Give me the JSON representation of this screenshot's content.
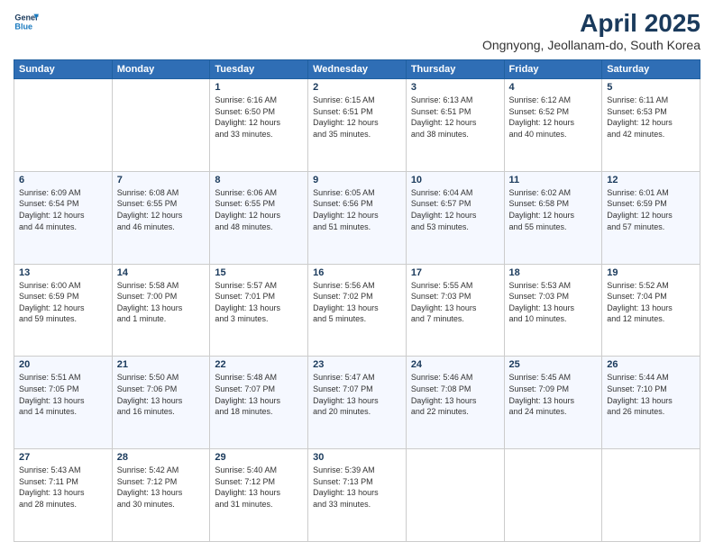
{
  "logo": {
    "line1": "General",
    "line2": "Blue"
  },
  "title": "April 2025",
  "subtitle": "Ongnyong, Jeollanam-do, South Korea",
  "days_header": [
    "Sunday",
    "Monday",
    "Tuesday",
    "Wednesday",
    "Thursday",
    "Friday",
    "Saturday"
  ],
  "weeks": [
    [
      {
        "day": "",
        "info": ""
      },
      {
        "day": "",
        "info": ""
      },
      {
        "day": "1",
        "info": "Sunrise: 6:16 AM\nSunset: 6:50 PM\nDaylight: 12 hours\nand 33 minutes."
      },
      {
        "day": "2",
        "info": "Sunrise: 6:15 AM\nSunset: 6:51 PM\nDaylight: 12 hours\nand 35 minutes."
      },
      {
        "day": "3",
        "info": "Sunrise: 6:13 AM\nSunset: 6:51 PM\nDaylight: 12 hours\nand 38 minutes."
      },
      {
        "day": "4",
        "info": "Sunrise: 6:12 AM\nSunset: 6:52 PM\nDaylight: 12 hours\nand 40 minutes."
      },
      {
        "day": "5",
        "info": "Sunrise: 6:11 AM\nSunset: 6:53 PM\nDaylight: 12 hours\nand 42 minutes."
      }
    ],
    [
      {
        "day": "6",
        "info": "Sunrise: 6:09 AM\nSunset: 6:54 PM\nDaylight: 12 hours\nand 44 minutes."
      },
      {
        "day": "7",
        "info": "Sunrise: 6:08 AM\nSunset: 6:55 PM\nDaylight: 12 hours\nand 46 minutes."
      },
      {
        "day": "8",
        "info": "Sunrise: 6:06 AM\nSunset: 6:55 PM\nDaylight: 12 hours\nand 48 minutes."
      },
      {
        "day": "9",
        "info": "Sunrise: 6:05 AM\nSunset: 6:56 PM\nDaylight: 12 hours\nand 51 minutes."
      },
      {
        "day": "10",
        "info": "Sunrise: 6:04 AM\nSunset: 6:57 PM\nDaylight: 12 hours\nand 53 minutes."
      },
      {
        "day": "11",
        "info": "Sunrise: 6:02 AM\nSunset: 6:58 PM\nDaylight: 12 hours\nand 55 minutes."
      },
      {
        "day": "12",
        "info": "Sunrise: 6:01 AM\nSunset: 6:59 PM\nDaylight: 12 hours\nand 57 minutes."
      }
    ],
    [
      {
        "day": "13",
        "info": "Sunrise: 6:00 AM\nSunset: 6:59 PM\nDaylight: 12 hours\nand 59 minutes."
      },
      {
        "day": "14",
        "info": "Sunrise: 5:58 AM\nSunset: 7:00 PM\nDaylight: 13 hours\nand 1 minute."
      },
      {
        "day": "15",
        "info": "Sunrise: 5:57 AM\nSunset: 7:01 PM\nDaylight: 13 hours\nand 3 minutes."
      },
      {
        "day": "16",
        "info": "Sunrise: 5:56 AM\nSunset: 7:02 PM\nDaylight: 13 hours\nand 5 minutes."
      },
      {
        "day": "17",
        "info": "Sunrise: 5:55 AM\nSunset: 7:03 PM\nDaylight: 13 hours\nand 7 minutes."
      },
      {
        "day": "18",
        "info": "Sunrise: 5:53 AM\nSunset: 7:03 PM\nDaylight: 13 hours\nand 10 minutes."
      },
      {
        "day": "19",
        "info": "Sunrise: 5:52 AM\nSunset: 7:04 PM\nDaylight: 13 hours\nand 12 minutes."
      }
    ],
    [
      {
        "day": "20",
        "info": "Sunrise: 5:51 AM\nSunset: 7:05 PM\nDaylight: 13 hours\nand 14 minutes."
      },
      {
        "day": "21",
        "info": "Sunrise: 5:50 AM\nSunset: 7:06 PM\nDaylight: 13 hours\nand 16 minutes."
      },
      {
        "day": "22",
        "info": "Sunrise: 5:48 AM\nSunset: 7:07 PM\nDaylight: 13 hours\nand 18 minutes."
      },
      {
        "day": "23",
        "info": "Sunrise: 5:47 AM\nSunset: 7:07 PM\nDaylight: 13 hours\nand 20 minutes."
      },
      {
        "day": "24",
        "info": "Sunrise: 5:46 AM\nSunset: 7:08 PM\nDaylight: 13 hours\nand 22 minutes."
      },
      {
        "day": "25",
        "info": "Sunrise: 5:45 AM\nSunset: 7:09 PM\nDaylight: 13 hours\nand 24 minutes."
      },
      {
        "day": "26",
        "info": "Sunrise: 5:44 AM\nSunset: 7:10 PM\nDaylight: 13 hours\nand 26 minutes."
      }
    ],
    [
      {
        "day": "27",
        "info": "Sunrise: 5:43 AM\nSunset: 7:11 PM\nDaylight: 13 hours\nand 28 minutes."
      },
      {
        "day": "28",
        "info": "Sunrise: 5:42 AM\nSunset: 7:12 PM\nDaylight: 13 hours\nand 30 minutes."
      },
      {
        "day": "29",
        "info": "Sunrise: 5:40 AM\nSunset: 7:12 PM\nDaylight: 13 hours\nand 31 minutes."
      },
      {
        "day": "30",
        "info": "Sunrise: 5:39 AM\nSunset: 7:13 PM\nDaylight: 13 hours\nand 33 minutes."
      },
      {
        "day": "",
        "info": ""
      },
      {
        "day": "",
        "info": ""
      },
      {
        "day": "",
        "info": ""
      }
    ]
  ]
}
